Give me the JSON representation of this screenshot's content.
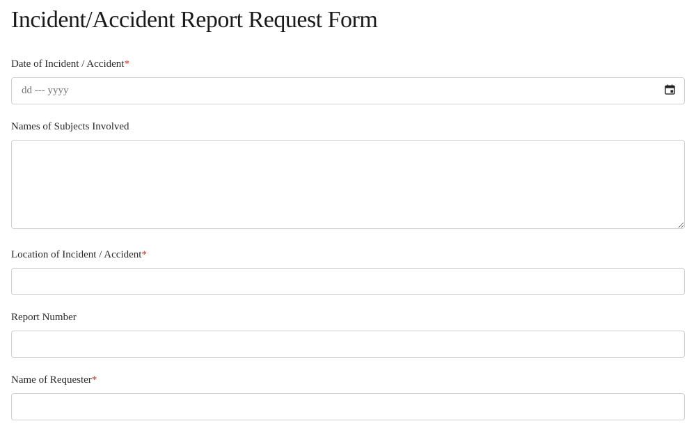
{
  "page": {
    "title": "Incident/Accident Report Request Form"
  },
  "fields": {
    "date": {
      "label": "Date of Incident / Accident",
      "required": "*",
      "placeholder": "dd --- yyyy",
      "value": ""
    },
    "subjects": {
      "label": "Names of Subjects Involved",
      "value": ""
    },
    "location": {
      "label": "Location of Incident / Accident",
      "required": "*",
      "value": ""
    },
    "report_number": {
      "label": "Report Number",
      "value": ""
    },
    "requester": {
      "label": "Name of Requester",
      "required": "*",
      "value": ""
    }
  }
}
